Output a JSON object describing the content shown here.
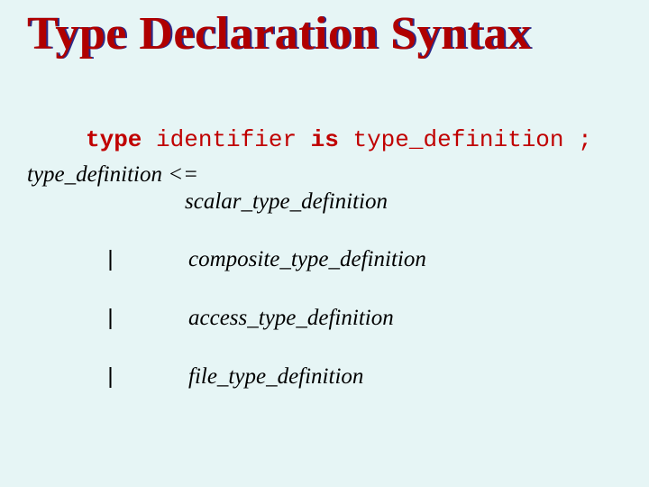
{
  "title": "Type Declaration Syntax",
  "syntax": {
    "kw_type": "type",
    "identifier": " identifier ",
    "kw_is": "is",
    "typedef": " type_definition ;"
  },
  "grammar": {
    "lhs": "type_definition <=",
    "first": "scalar_type_definition",
    "alts": [
      {
        "pipe": "|",
        "name": "composite_type_definition"
      },
      {
        "pipe": "|",
        "name": "access_type_definition"
      },
      {
        "pipe": "|",
        "name": "file_type_definition"
      }
    ]
  }
}
